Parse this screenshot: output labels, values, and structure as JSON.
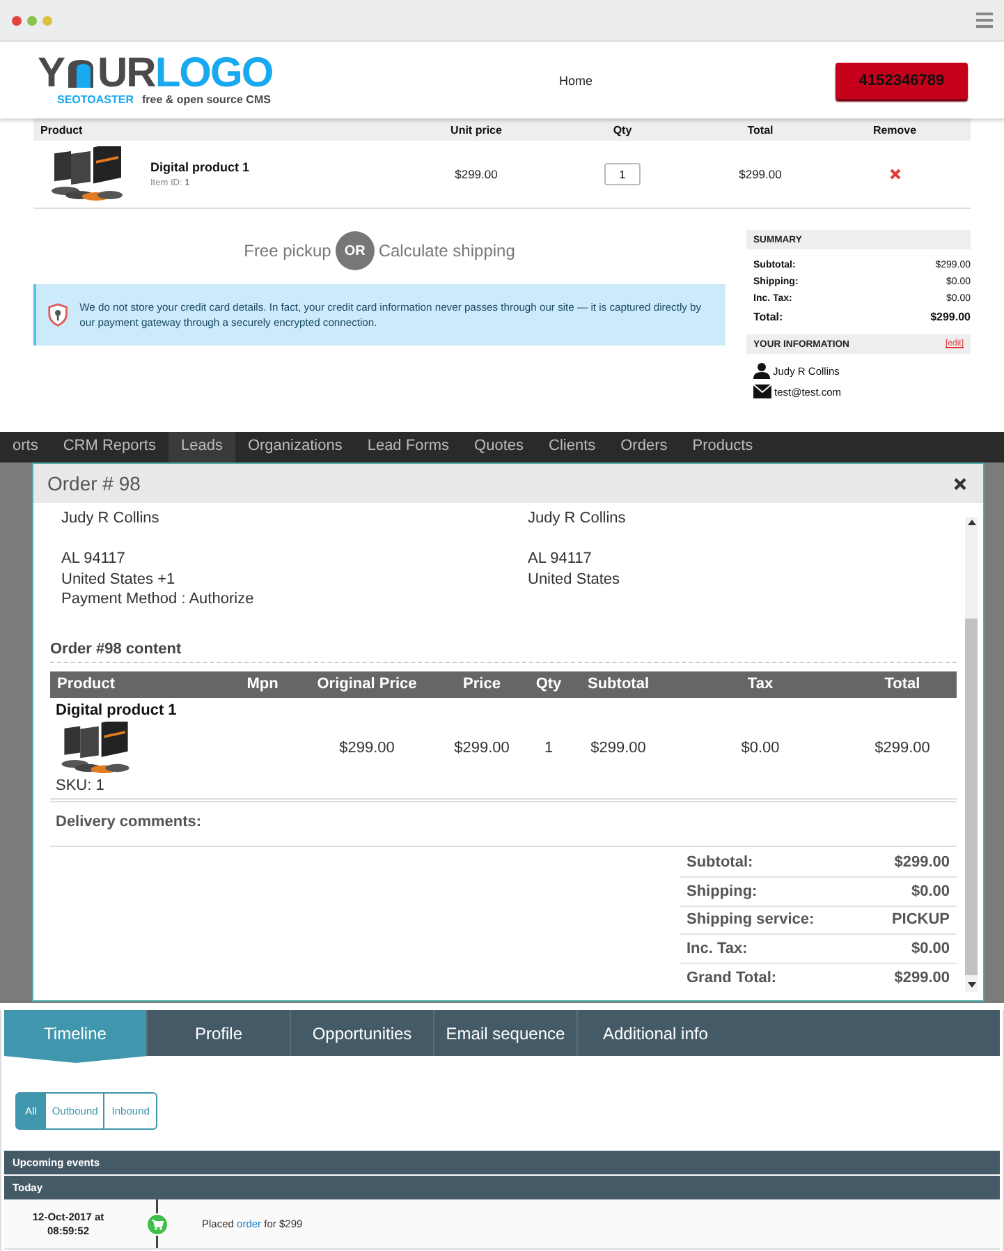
{
  "header": {
    "logo": {
      "part1": "Y",
      "part2": "UR",
      "part3": "LOGO",
      "brand": "SEOTOASTER",
      "tagline": "free & open source CMS"
    },
    "nav": [
      "Home"
    ],
    "phone_button": "4152346789"
  },
  "cart": {
    "columns": [
      "Product",
      "Unit price",
      "Qty",
      "Total",
      "Remove"
    ],
    "items": [
      {
        "name": "Digital product 1",
        "item_id_label": "Item ID:",
        "item_id": "1",
        "unit_price": "$299.00",
        "qty": "1",
        "total": "$299.00"
      }
    ]
  },
  "shipping_choice": {
    "left": "Free pickup",
    "or": "OR",
    "right": "Calculate shipping"
  },
  "notice": "We do not store your credit card details. In fact, your credit card information never passes through our site — it is captured directly by our payment gateway through a securely encrypted connection.",
  "summary": {
    "title": "SUMMARY",
    "rows": [
      {
        "label": "Subtotal:",
        "value": "$299.00",
        "kind": "line"
      },
      {
        "label": "Shipping:",
        "value": "$0.00",
        "kind": "line"
      },
      {
        "label": "Inc. Tax:",
        "value": "$0.00",
        "kind": "line"
      },
      {
        "label": "Total:",
        "value": "$299.00",
        "kind": "total"
      }
    ]
  },
  "your_information": {
    "title": "YOUR INFORMATION",
    "edit": "[edit]",
    "name": "Judy R Collins",
    "email": "test@test.com"
  },
  "backdrop_nav": [
    {
      "label": "orts",
      "selected": false
    },
    {
      "label": "CRM Reports",
      "selected": false
    },
    {
      "label": "Leads",
      "selected": true
    },
    {
      "label": "Organizations",
      "selected": false
    },
    {
      "label": "Lead Forms",
      "selected": false
    },
    {
      "label": "Quotes",
      "selected": false
    },
    {
      "label": "Clients",
      "selected": false
    },
    {
      "label": "Orders",
      "selected": false
    },
    {
      "label": "Products",
      "selected": false
    }
  ],
  "order_dialog": {
    "title": "Order # 98",
    "billing": {
      "name": "Judy R Collins",
      "lines": [
        "AL 94117",
        "United States +1",
        "Payment Method : Authorize"
      ]
    },
    "shipping": {
      "name": "Judy R Collins",
      "lines": [
        "AL 94117",
        "United States"
      ]
    },
    "content_title": "Order #98 content",
    "columns": [
      "Product",
      "Mpn",
      "Original Price",
      "Price",
      "Qty",
      "Subtotal",
      "Tax",
      "Total"
    ],
    "rows": [
      {
        "product": "Digital product 1",
        "sku": "SKU: 1",
        "original_price": "$299.00",
        "price": "$299.00",
        "qty": "1",
        "subtotal": "$299.00",
        "tax": "$0.00",
        "total": "$299.00"
      }
    ],
    "delivery_comments_label": "Delivery comments:",
    "totals": [
      {
        "label": "Subtotal:",
        "value": "$299.00"
      },
      {
        "label": "Shipping:",
        "value": "$0.00"
      },
      {
        "label": "Shipping service:",
        "value": "PICKUP"
      },
      {
        "label": "Inc. Tax:",
        "value": "$0.00"
      },
      {
        "label": "Grand Total:",
        "value": "$299.00"
      }
    ]
  },
  "tabs": [
    {
      "label": "Timeline",
      "selected": true
    },
    {
      "label": "Profile",
      "selected": false
    },
    {
      "label": "Opportunities",
      "selected": false
    },
    {
      "label": "Email sequence",
      "selected": false
    },
    {
      "label": "Additional info",
      "selected": false
    }
  ],
  "filters": [
    {
      "label": "All",
      "selected": true
    },
    {
      "label": "Outbound",
      "selected": false
    },
    {
      "label": "Inbound",
      "selected": false
    }
  ],
  "timeline": {
    "section": "Upcoming events",
    "group": "Today",
    "events": [
      {
        "date": "12-Oct-2017 at 08:59:52",
        "text_before": "Placed",
        "link": "order",
        "text_after": "for $299"
      }
    ]
  }
}
